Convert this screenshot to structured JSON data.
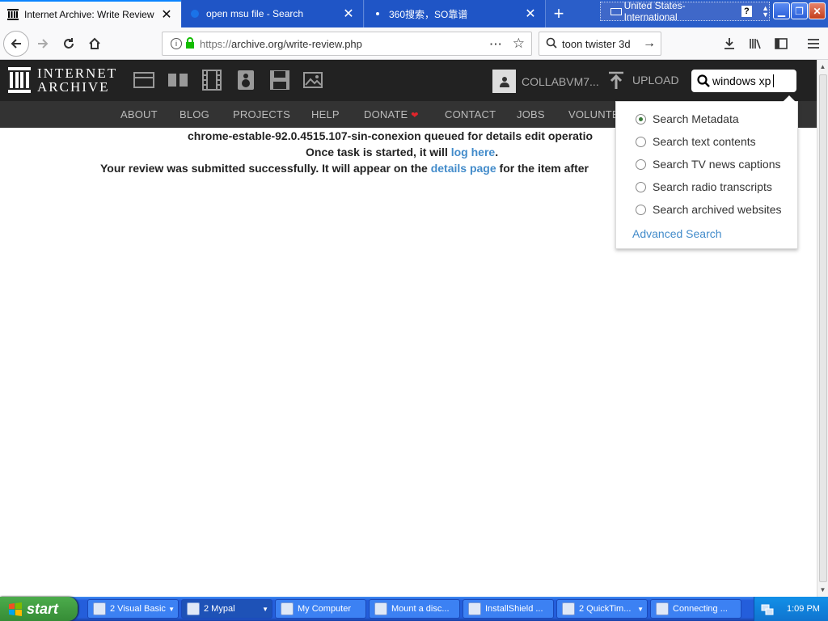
{
  "browser": {
    "tabs": [
      {
        "label": "Internet Archive: Write Review",
        "active": true
      },
      {
        "label": "open msu file - Search",
        "active": false
      },
      {
        "label": "360搜索，SO靠谱",
        "active": false
      }
    ],
    "new_tab_glyph": "+",
    "language_bar": "United States-International",
    "url_prefix": "https://",
    "url_main": "archive.org/write-review.php",
    "search_query": "toon twister 3d"
  },
  "archive": {
    "logo_line1": "INTERNET",
    "logo_line2": "ARCHIVE",
    "username": "COLLABVM7...",
    "upload_label": "UPLOAD",
    "search_value": "windows xp",
    "nav": [
      "ABOUT",
      "BLOG",
      "PROJECTS",
      "HELP",
      "DONATE",
      "CONTACT",
      "JOBS",
      "VOLUNTE"
    ]
  },
  "message": {
    "line1": "chrome-estable-92.0.4515.107-sin-conexion queued for details edit operatio",
    "line2_pre": "Once task is started, it will ",
    "line2_link": "log here",
    "line2_post": ".",
    "line3_pre": "Your review was submitted successfully. It will appear on the ",
    "line3_link": "details page",
    "line3_post": " for the item after"
  },
  "search_options": {
    "options": [
      {
        "label": "Search Metadata",
        "selected": true
      },
      {
        "label": "Search text contents",
        "selected": false
      },
      {
        "label": "Search TV news captions",
        "selected": false
      },
      {
        "label": "Search radio transcripts",
        "selected": false
      },
      {
        "label": "Search archived websites",
        "selected": false
      }
    ],
    "advanced": "Advanced Search"
  },
  "taskbar": {
    "start": "start",
    "tasks": [
      "2 Visual Basic",
      "2 Mypal",
      "My Computer",
      "Mount a disc...",
      "InstallShield ...",
      "2 QuickTim...",
      "Connecting ..."
    ],
    "clock": "1:09 PM"
  },
  "colors": {
    "accent_link": "#428bca",
    "ia_dark": "#222222",
    "xp_blue": "#245edb",
    "start_green": "#368c36"
  }
}
